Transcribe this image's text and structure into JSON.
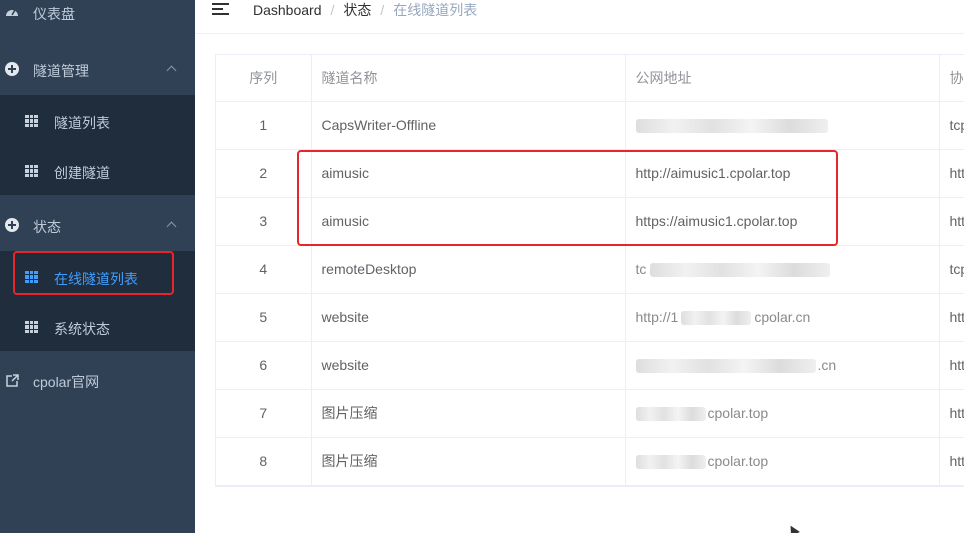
{
  "sidebar": {
    "items": [
      {
        "label": "仪表盘",
        "icon": "dashboard-icon"
      },
      {
        "label": "隧道管理",
        "icon": "plus-circle-icon"
      },
      {
        "label": "隧道列表",
        "icon": "grid-icon"
      },
      {
        "label": "创建隧道",
        "icon": "grid-icon"
      },
      {
        "label": "状态",
        "icon": "plus-circle-icon"
      },
      {
        "label": "在线隧道列表",
        "icon": "grid-icon"
      },
      {
        "label": "系统状态",
        "icon": "grid-icon"
      },
      {
        "label": "cpolar官网",
        "icon": "external-link-icon"
      }
    ]
  },
  "breadcrumb": {
    "home": "Dashboard",
    "parent": "状态",
    "current": "在线隧道列表",
    "separator": "/"
  },
  "table": {
    "headers": [
      "序列",
      "隧道名称",
      "公网地址",
      "协"
    ],
    "rows": [
      {
        "idx": "1",
        "name": "CapsWriter-Offline",
        "url": "",
        "proto": "tcp"
      },
      {
        "idx": "2",
        "name": "aimusic",
        "url": "http://aimusic1.cpolar.top",
        "proto": "http"
      },
      {
        "idx": "3",
        "name": "aimusic",
        "url": "https://aimusic1.cpolar.top",
        "proto": "http"
      },
      {
        "idx": "4",
        "name": "remoteDesktop",
        "url": "",
        "proto": "tcp"
      },
      {
        "idx": "5",
        "name": "website",
        "url": "",
        "proto": "http"
      },
      {
        "idx": "6",
        "name": "website",
        "url": "",
        "proto": "http"
      },
      {
        "idx": "7",
        "name": "图片压缩",
        "url": "",
        "proto": "http"
      },
      {
        "idx": "8",
        "name": "图片压缩",
        "url": "",
        "proto": "http"
      }
    ],
    "partial_urls": {
      "r4": "tc",
      "r5a": "http://1",
      "r5b": "cpolar.cn",
      "r6b": ".cn",
      "r7": "cpolar.top",
      "r8": "cpolar.top"
    }
  },
  "colors": {
    "sidebar_bg": "#304156",
    "submenu_bg": "#1f2d3d",
    "active": "#409eff",
    "highlight": "#e8262a"
  }
}
